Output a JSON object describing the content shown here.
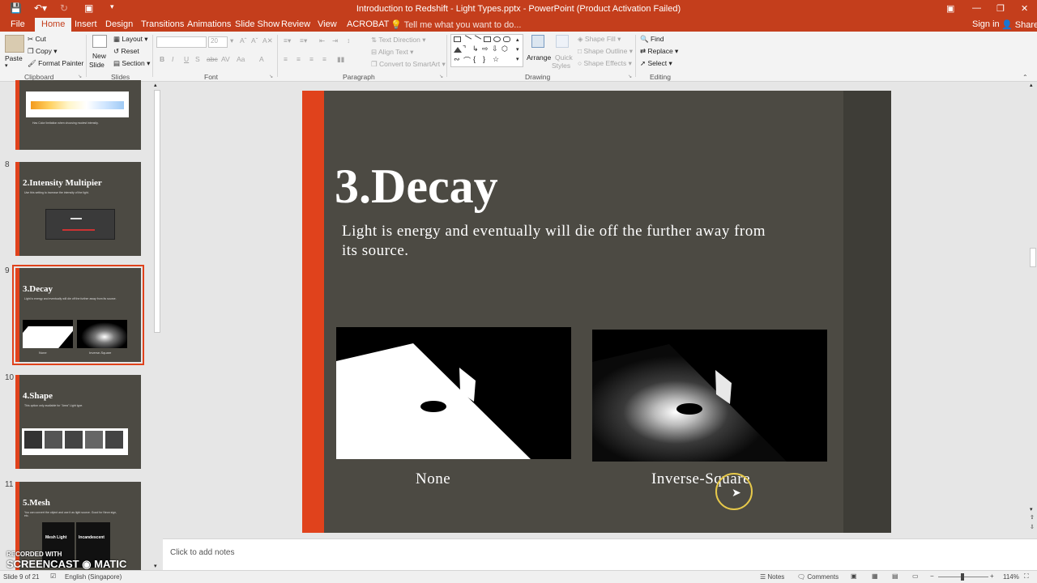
{
  "window": {
    "title": "Introduction to Redshift - Light Types.pptx - PowerPoint (Product Activation Failed)",
    "signin": "Sign in",
    "share": "Share"
  },
  "tabs": [
    "File",
    "Home",
    "Insert",
    "Design",
    "Transitions",
    "Animations",
    "Slide Show",
    "Review",
    "View",
    "ACROBAT"
  ],
  "tellme": "Tell me what you want to do...",
  "ribbon": {
    "clipboard": {
      "paste": "Paste",
      "cut": "Cut",
      "copy": "Copy",
      "format_painter": "Format Painter",
      "label": "Clipboard"
    },
    "slides": {
      "new_slide_1": "New",
      "new_slide_2": "Slide",
      "layout": "Layout",
      "reset": "Reset",
      "section": "Section",
      "label": "Slides"
    },
    "font": {
      "size": "20",
      "label": "Font"
    },
    "paragraph": {
      "text_direction": "Text Direction",
      "align_text": "Align Text",
      "convert_smartart": "Convert to SmartArt",
      "label": "Paragraph"
    },
    "drawing": {
      "arrange": "Arrange",
      "quick_styles_1": "Quick",
      "quick_styles_2": "Styles",
      "shape_fill": "Shape Fill",
      "shape_outline": "Shape Outline",
      "shape_effects": "Shape Effects",
      "label": "Drawing"
    },
    "editing": {
      "find": "Find",
      "replace": "Replace",
      "select": "Select",
      "label": "Editing"
    }
  },
  "thumbnails": [
    {
      "num": "",
      "title": "",
      "sub": "Has Color limitation when choosing modest intensity."
    },
    {
      "num": "8",
      "title": "2.Intensity Multipier",
      "sub": "Use this setting to increase the intensity of the light."
    },
    {
      "num": "9",
      "title": "3.Decay",
      "sub": "Light is energy and eventually will die off the further away from its source.",
      "cap1": "None",
      "cap2": "Inverse-Square"
    },
    {
      "num": "10",
      "title": "4.Shape",
      "sub": "This option only available for \"Area\" Light type."
    },
    {
      "num": "11",
      "title": "5.Mesh",
      "sub": "You can convert the object and use it as light source. Good for Neon sign, etc.",
      "img1": "Mesh Light",
      "img2": "Incandescent"
    }
  ],
  "slide": {
    "title": "3.Decay",
    "body": "Light is energy and eventually will die off the further away from its source.",
    "caption_left": "None",
    "caption_right": "Inverse-Square"
  },
  "notes": {
    "placeholder": "Click to add notes"
  },
  "status": {
    "slide": "Slide 9 of 21",
    "language": "English (Singapore)",
    "notes": "Notes",
    "comments": "Comments",
    "zoom": "114%"
  },
  "watermark": {
    "line1": "RECORDED WITH",
    "line2": "SCREENCAST",
    "line3": "MATIC"
  }
}
